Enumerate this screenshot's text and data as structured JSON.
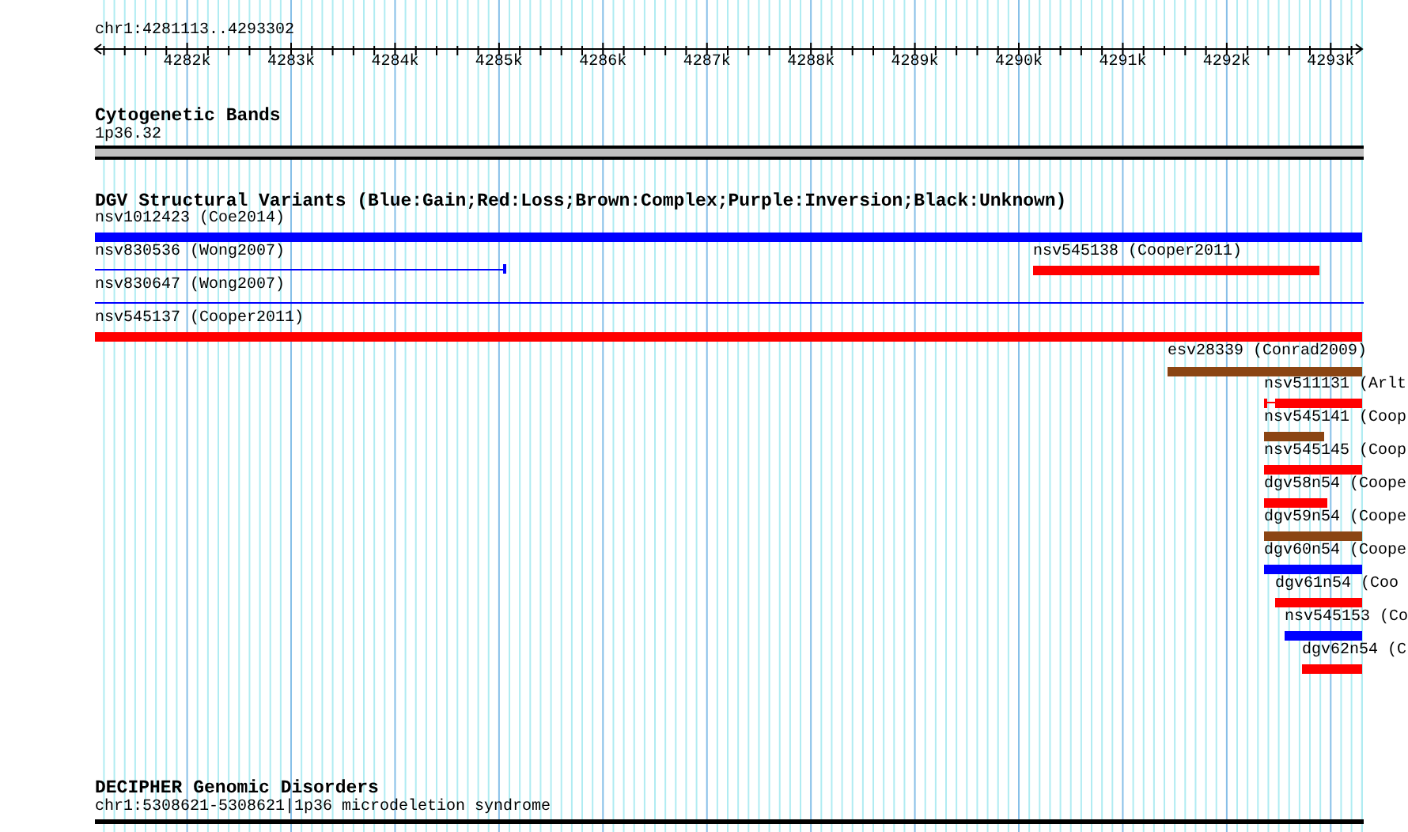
{
  "ruler": {
    "region": "chr1:4281113..4293302",
    "ticks": [
      "4282k",
      "4283k",
      "4284k",
      "4285k",
      "4286k",
      "4287k",
      "4288k",
      "4289k",
      "4290k",
      "4291k",
      "4292k",
      "4293k"
    ]
  },
  "tracks": [
    {
      "kind": "bands",
      "title": "Cytogenetic Bands",
      "features": [
        {
          "label": "1p36.32",
          "kind": "bar"
        }
      ]
    },
    {
      "kind": "variants",
      "title": "DGV Structural Variants (Blue:Gain;Red:Loss;Brown:Complex;Purple:Inversion;Black:Unknown)",
      "features": [
        {
          "label": "nsv1012423 (Coe2014)",
          "kind": "bar",
          "color": "#0000ff"
        },
        {
          "label": "nsv830536 (Wong2007)",
          "kind": "line",
          "color": "#0000ff"
        },
        {
          "label": "nsv545138 (Cooper2011)",
          "kind": "bar",
          "color": "#ff0000"
        },
        {
          "label": "nsv830647 (Wong2007)",
          "kind": "line",
          "color": "#0000ff"
        },
        {
          "label": "nsv545137 (Cooper2011)",
          "kind": "bar",
          "color": "#ff0000"
        },
        {
          "label": "esv28339 (Conrad2009)",
          "kind": "bar",
          "color": "#8b4513"
        },
        {
          "label": "nsv511131 (Arlt",
          "kind": "bar",
          "color": "#ff0000"
        },
        {
          "label": "nsv545141 (Coop",
          "kind": "bar",
          "color": "#8b4513"
        },
        {
          "label": "nsv545145 (Coop",
          "kind": "bar",
          "color": "#ff0000"
        },
        {
          "label": "dgv58n54 (Coope",
          "kind": "bar",
          "color": "#ff0000"
        },
        {
          "label": "dgv59n54 (Coope",
          "kind": "bar",
          "color": "#8b4513"
        },
        {
          "label": "dgv60n54 (Coope",
          "kind": "bar",
          "color": "#0000ff"
        },
        {
          "label": "dgv61n54 (Coo",
          "kind": "bar",
          "color": "#ff0000"
        },
        {
          "label": "nsv545153 (Co",
          "kind": "bar",
          "color": "#0000ff"
        },
        {
          "label": "dgv62n54 (C",
          "kind": "bar",
          "color": "#ff0000"
        }
      ]
    },
    {
      "kind": "disorders",
      "title": "DECIPHER Genomic Disorders",
      "features": [
        {
          "label": "chr1:5308621-5308621|1p36 microdeletion syndrome",
          "kind": "bar"
        }
      ]
    }
  ]
}
